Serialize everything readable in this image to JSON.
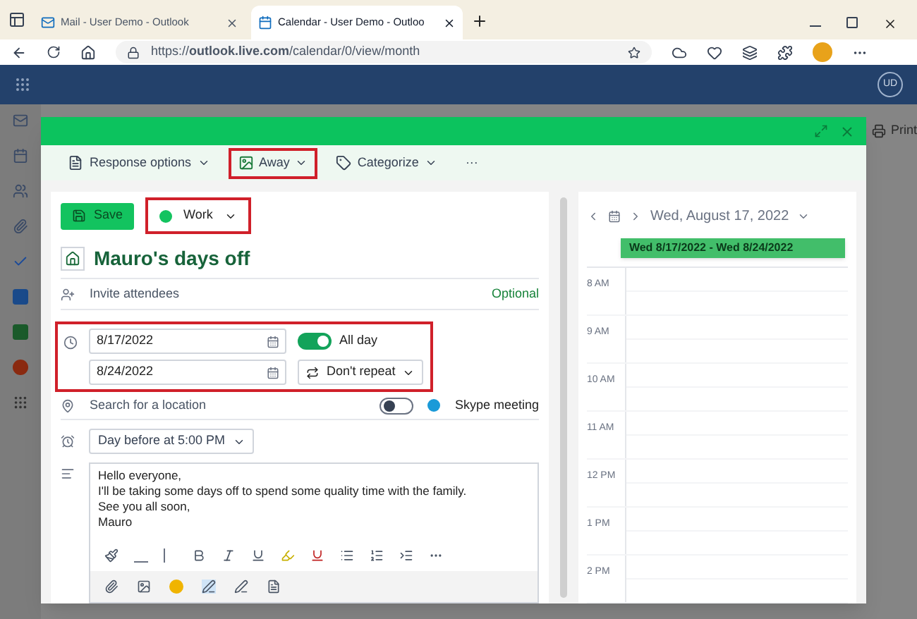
{
  "browser": {
    "tabs": [
      {
        "title": "Mail - User Demo - Outlook",
        "selected": false
      },
      {
        "title": "Calendar - User Demo - Outloo",
        "selected": true
      }
    ],
    "url": "https://**outlook.live.com**/calendar/0/view/month"
  },
  "app_bar": {
    "avatar": "UD"
  },
  "background": {
    "print": "Print"
  },
  "dialog": {
    "toolbar": [
      {
        "kind": "response",
        "label": "Response options",
        "highlighted": false
      },
      {
        "kind": "away",
        "label": "Away",
        "highlighted": true
      },
      {
        "kind": "category",
        "label": "Categorize",
        "highlighted": false
      },
      {
        "kind": "more",
        "label": "···",
        "highlighted": false
      }
    ],
    "save": "Save",
    "category": {
      "label": "Work",
      "color": "#13c35f",
      "highlighted": true
    },
    "title": "Mauro's days off",
    "invite": {
      "placeholder": "Invite attendees",
      "optional": "Optional"
    },
    "when": {
      "highlighted": true,
      "start": "8/17/2022",
      "end": "8/24/2022",
      "all_day": {
        "label": "All day",
        "on": true
      },
      "repeat": "Don't repeat"
    },
    "location": {
      "placeholder": "Search for a location",
      "skype": {
        "label": "Skype meeting",
        "on": false
      }
    },
    "reminder": "Day before at 5:00 PM",
    "body": [
      "Hello everyone,",
      "I'll be taking some days off to spend some quality time with the family.",
      "See you all soon,",
      "Mauro"
    ],
    "calendar": {
      "date": "Wed, August 17, 2022",
      "event": "Wed 8/17/2022 - Wed 8/24/2022",
      "times": [
        "8 AM",
        "9 AM",
        "10 AM",
        "11 AM",
        "12 PM",
        "1 PM",
        "2 PM"
      ]
    }
  }
}
